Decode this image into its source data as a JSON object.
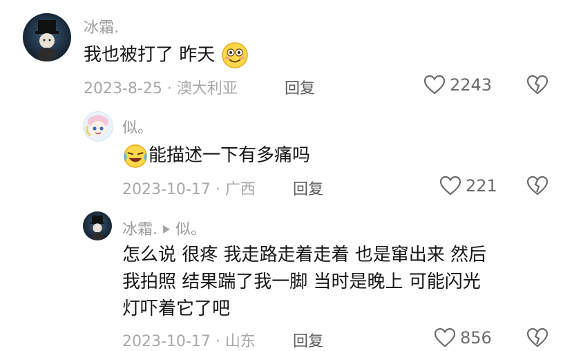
{
  "comments": [
    {
      "username": "冰霜.",
      "text": "我也被打了 昨天",
      "date_location": "2023-8-25 · 澳大利亚",
      "reply_label": "回复",
      "likes": "2243"
    },
    {
      "username": "似。",
      "text": "能描述一下有多痛吗",
      "date_location": "2023-10-17 · 广西",
      "reply_label": "回复",
      "likes": "221"
    },
    {
      "username": "冰霜.",
      "reply_to": "似。",
      "text_lines": [
        "怎么说 很疼 我走路走着走着 也是窜出来 然后",
        "我拍照 结果踹了我一脚 当时是晚上 可能闪光",
        "灯吓着它了吧"
      ],
      "date_location": "2023-10-17 · 山东",
      "reply_label": "回复",
      "likes": "856"
    }
  ],
  "icons": {
    "like": "heart-outline-icon",
    "dislike": "broken-heart-icon",
    "emoji_1": "smiling-face-emoji",
    "emoji_2": "crying-laughing-face-emoji",
    "reply_arrow": "play-triangle-icon"
  }
}
